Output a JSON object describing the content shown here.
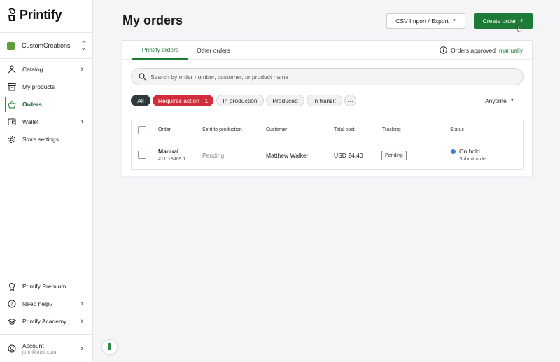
{
  "brand": {
    "name": "Printify",
    "accent": "#1d7a37"
  },
  "store": {
    "name": "CustomCreations"
  },
  "sidebar": {
    "items": [
      {
        "label": "Catalog",
        "icon": "catalog-icon",
        "chevron": true
      },
      {
        "label": "My products",
        "icon": "archive-icon",
        "chevron": false
      },
      {
        "label": "Orders",
        "icon": "basket-icon",
        "chevron": false,
        "active": true
      },
      {
        "label": "Wallet",
        "icon": "wallet-icon",
        "chevron": true
      },
      {
        "label": "Store settings",
        "icon": "gear-icon",
        "chevron": false
      }
    ],
    "bottom_items": [
      {
        "label": "Printify Premium",
        "icon": "premium-icon",
        "chevron": false
      },
      {
        "label": "Need help?",
        "icon": "help-icon",
        "chevron": true
      },
      {
        "label": "Printify Academy",
        "icon": "graduation-cap-icon",
        "chevron": true
      }
    ],
    "account": {
      "label": "Account",
      "email": "john@mail.com"
    }
  },
  "header": {
    "title": "My orders",
    "csv_button": "CSV Import / Export",
    "create_button": "Create order"
  },
  "tabs": [
    {
      "label": "Printify orders",
      "active": true
    },
    {
      "label": "Other orders",
      "active": false
    }
  ],
  "approval": {
    "text": "Orders approved",
    "link": "manually"
  },
  "search": {
    "placeholder": "Search by order number, customer, or product name"
  },
  "filters": {
    "chips": [
      {
        "label": "All",
        "style": "selected"
      },
      {
        "label": "Requires action · 1",
        "style": "alert"
      },
      {
        "label": "In production",
        "style": "default"
      },
      {
        "label": "Produced",
        "style": "default"
      },
      {
        "label": "In transit",
        "style": "default"
      },
      {
        "label": "···",
        "style": "default"
      }
    ],
    "date": "Anytime"
  },
  "table": {
    "columns": [
      "Order",
      "Sent to production",
      "Customer",
      "Total cost",
      "Tracking",
      "Status"
    ],
    "rows": [
      {
        "order_type": "Manual",
        "order_number": "#11118409.1",
        "sent": "Pending",
        "customer": "Matthew Walker",
        "total": "USD 24.40",
        "tracking": "Pending",
        "status": "On hold",
        "status_action": "Submit order",
        "status_color": "#3f83c7"
      }
    ]
  }
}
